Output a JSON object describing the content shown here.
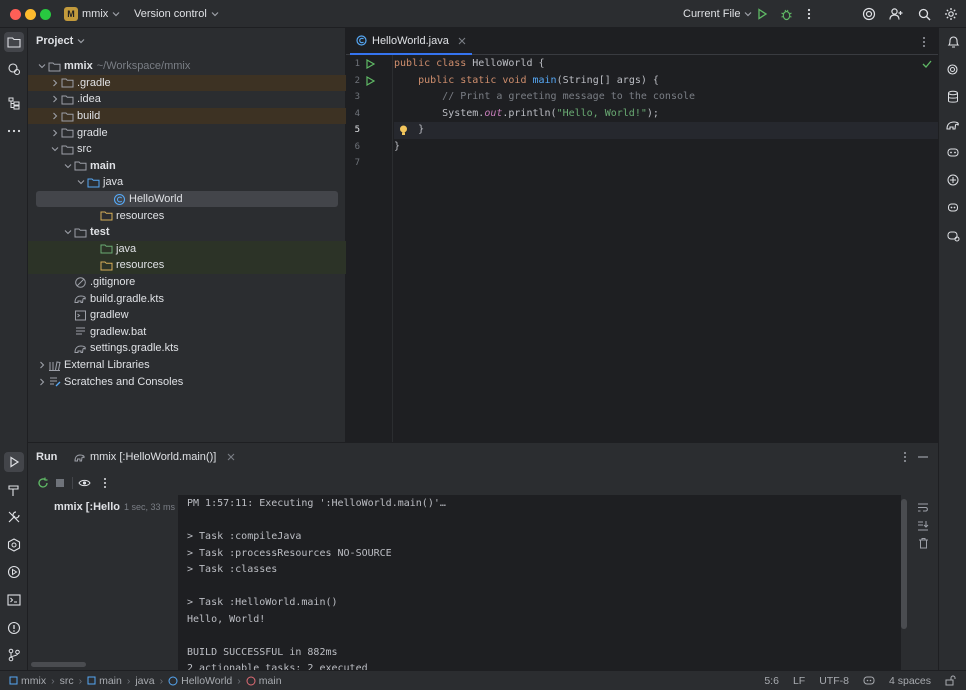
{
  "titlebar": {
    "project_badge": "M",
    "project_name": "mmix",
    "vcs_label": "Version control",
    "run_config": "Current File"
  },
  "project_panel": {
    "title": "Project",
    "tree": [
      {
        "label": "mmix",
        "suffix": "~/Workspace/mmix",
        "indent": 0,
        "arrow": "down",
        "icon": "module-folder-icon",
        "bold": true
      },
      {
        "label": ".gradle",
        "indent": 1,
        "arrow": "right",
        "icon": "folder-icon",
        "highlight": "orange"
      },
      {
        "label": ".idea",
        "indent": 1,
        "arrow": "right",
        "icon": "folder-icon"
      },
      {
        "label": "build",
        "indent": 1,
        "arrow": "right",
        "icon": "folder-icon",
        "highlight": "orange"
      },
      {
        "label": "gradle",
        "indent": 1,
        "arrow": "right",
        "icon": "folder-icon"
      },
      {
        "label": "src",
        "indent": 1,
        "arrow": "down",
        "icon": "folder-icon"
      },
      {
        "label": "main",
        "indent": 2,
        "arrow": "down",
        "icon": "folder-icon",
        "bold": true
      },
      {
        "label": "java",
        "indent": 3,
        "arrow": "down",
        "icon": "source-folder-icon"
      },
      {
        "label": "HelloWorld",
        "indent": 5,
        "arrow": "",
        "icon": "java-class-icon",
        "selected": true
      },
      {
        "label": "resources",
        "indent": 4,
        "arrow": "",
        "icon": "resources-folder-icon"
      },
      {
        "label": "test",
        "indent": 2,
        "arrow": "down",
        "icon": "folder-icon",
        "bold": true
      },
      {
        "label": "java",
        "indent": 4,
        "arrow": "",
        "icon": "test-folder-icon",
        "highlight": "green"
      },
      {
        "label": "resources",
        "indent": 4,
        "arrow": "",
        "icon": "test-resources-folder-icon",
        "highlight": "green"
      },
      {
        "label": ".gitignore",
        "indent": 2,
        "arrow": "",
        "icon": "ignore-file-icon"
      },
      {
        "label": "build.gradle.kts",
        "indent": 2,
        "arrow": "",
        "icon": "gradle-file-icon"
      },
      {
        "label": "gradlew",
        "indent": 2,
        "arrow": "",
        "icon": "script-file-icon"
      },
      {
        "label": "gradlew.bat",
        "indent": 2,
        "arrow": "",
        "icon": "text-file-icon"
      },
      {
        "label": "settings.gradle.kts",
        "indent": 2,
        "arrow": "",
        "icon": "gradle-file-icon"
      },
      {
        "label": "External Libraries",
        "indent": 0,
        "arrow": "right",
        "icon": "libraries-icon"
      },
      {
        "label": "Scratches and Consoles",
        "indent": 0,
        "arrow": "right",
        "icon": "scratches-icon"
      }
    ]
  },
  "editor": {
    "tab_label": "HelloWorld.java",
    "line_numbers": [
      "1",
      "2",
      "3",
      "4",
      "5",
      "6",
      "7"
    ]
  },
  "run_panel": {
    "title": "Run",
    "tab_label": "mmix [:HelloWorld.main()]",
    "tree_item": "mmix [:Hello",
    "tree_time": "1 sec, 33 ms",
    "console": [
      "PM 1:57:11: Executing ':HelloWorld.main()'…",
      "",
      "> Task :compileJava",
      "> Task :processResources NO-SOURCE",
      "> Task :classes",
      "",
      "> Task :HelloWorld.main()",
      "Hello, World!",
      "",
      "BUILD SUCCESSFUL in 882ms",
      "2 actionable tasks: 2 executed"
    ]
  },
  "statusbar": {
    "breadcrumbs": [
      "mmix",
      "src",
      "main",
      "java",
      "HelloWorld",
      "main"
    ],
    "caret": "5:6",
    "line_sep": "LF",
    "encoding": "UTF-8",
    "indent": "4 spaces"
  },
  "colors": {
    "accent": "#3574f0",
    "run_green": "#5fb865",
    "bg_dark": "#1e1f22",
    "panel": "#2b2d30"
  }
}
